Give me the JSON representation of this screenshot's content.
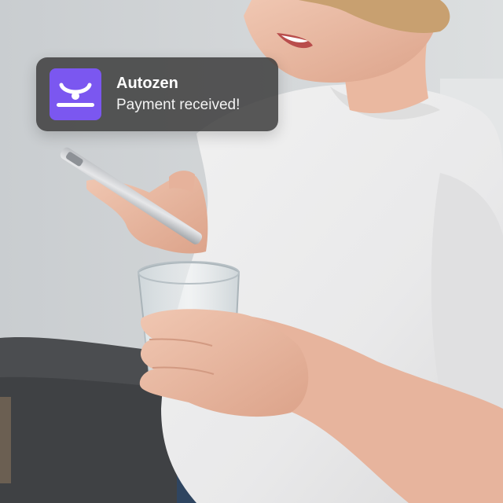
{
  "notification": {
    "app_name": "Autozen",
    "message": "Payment received!",
    "icon": "autozen-logo-icon",
    "icon_color": "#7b57f0",
    "background_color": "#3e3e3e"
  },
  "photo": {
    "subject": "woman-using-phone-holding-glass"
  }
}
